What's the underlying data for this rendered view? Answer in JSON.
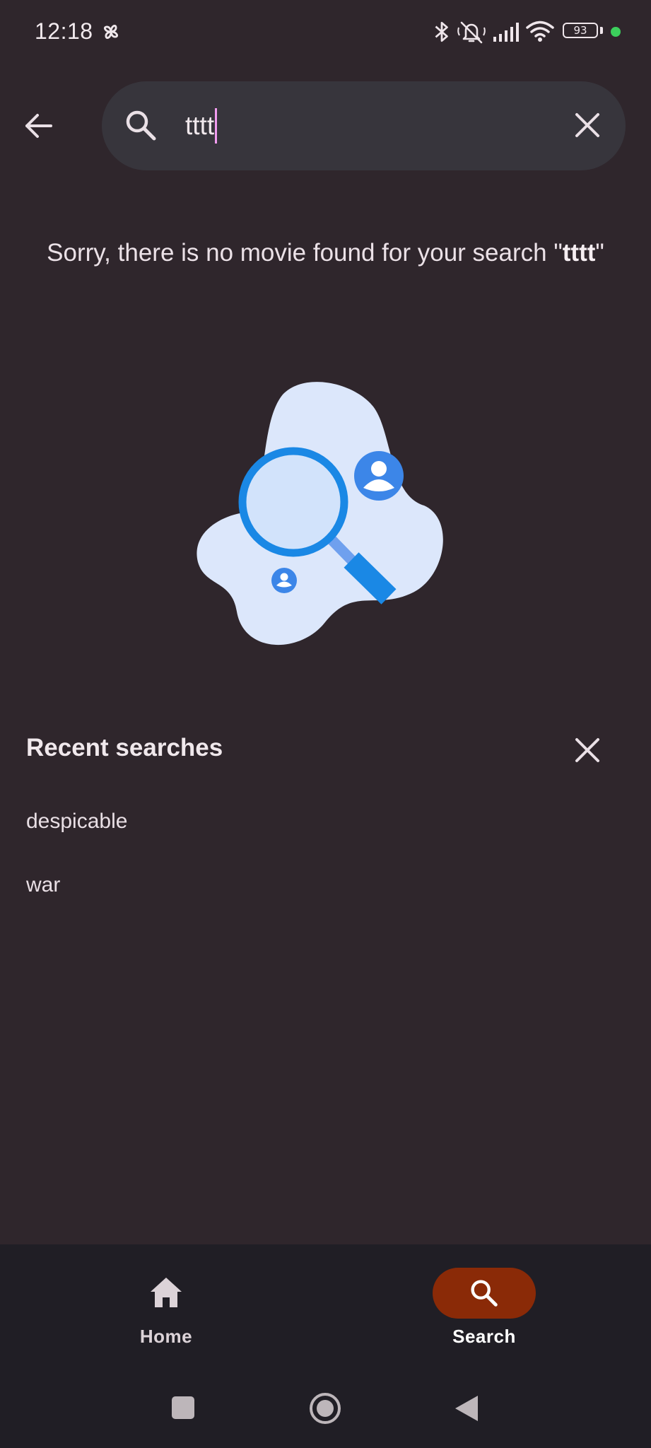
{
  "status_bar": {
    "time": "12:18",
    "battery": "93",
    "left_icon": "pinwheel-icon",
    "right_icons": [
      "bluetooth-icon",
      "silent-alarm-icon",
      "signal-icon",
      "wifi-icon",
      "battery-icon"
    ],
    "dot_color": "#3ccf5c"
  },
  "top_bar": {
    "back_icon": "arrow-left-icon",
    "search_icon": "search-icon",
    "clear_icon": "close-icon",
    "query": "tttt"
  },
  "message": {
    "prefix": "Sorry, there is no movie found for your search \"",
    "query": "tttt",
    "suffix": "\""
  },
  "illustration": {
    "name": "no-results-illustration",
    "blob_color": "#dce7fb",
    "accent_color": "#1a88e5"
  },
  "recent": {
    "title": "Recent searches",
    "clear_icon": "close-icon",
    "items": [
      "despicable",
      "war"
    ]
  },
  "bottom_nav": {
    "items": [
      {
        "label": "Home",
        "icon": "home-icon",
        "active": false
      },
      {
        "label": "Search",
        "icon": "search-icon",
        "active": true
      }
    ],
    "active_color": "#8a2a07"
  },
  "system_nav": {
    "buttons": [
      "recents-square-icon",
      "home-circle-icon",
      "back-triangle-icon"
    ]
  }
}
